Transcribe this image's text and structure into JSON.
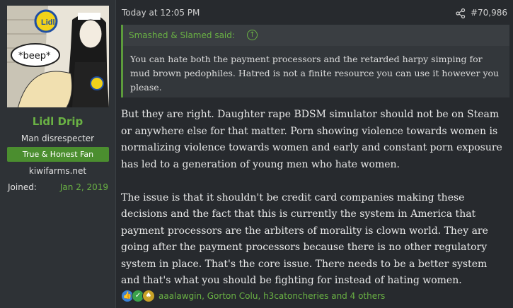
{
  "user": {
    "name": "Lidl Drip",
    "title": "Man disrespecter",
    "banner": "True & Honest Fan",
    "site": "kiwifarms.net",
    "joined_label": "Joined:",
    "joined_value": "Jan 2, 2019",
    "avatar_caption": "*beep*",
    "avatar_logo": "Lidl"
  },
  "post": {
    "timestamp": "Today at 12:05 PM",
    "post_number": "#70,986",
    "share_icon": "share-icon",
    "quote": {
      "author": "Smashed & Slamed said:",
      "arrow_icon": "arrow-up-icon",
      "text": "You can hate both the payment processors and the retarded harpy simping for mud brown pedophiles. Hatred is not a finite resource you can use it however you please."
    },
    "paragraphs": [
      "But they are right. Daughter rape BDSM simulator should not be on Steam or anywhere else for that matter. Porn showing violence towards women is normalizing violence towards women and early and constant porn exposure has led to a generation of young men who hate women.",
      "The issue is that it shouldn't be credit card companies making these decisions and the fact that this is currently the system in America that payment processors are the arbiters of morality is clown world. They are going after the payment processors because there is no other regulatory system in place. That's the core issue. There needs to be a better system and that's what you should be fighting for instead of hating women."
    ],
    "reactions": {
      "icons": [
        "thumbs-up-icon",
        "checkmark-icon",
        "pineapple-icon"
      ],
      "users": "aaalawgin, Gorton Colu, h3catoncheries and 4 others"
    }
  },
  "colors": {
    "background": "#272a2e",
    "accent_green": "#6ab244",
    "banner_green": "#4b8e2f"
  }
}
